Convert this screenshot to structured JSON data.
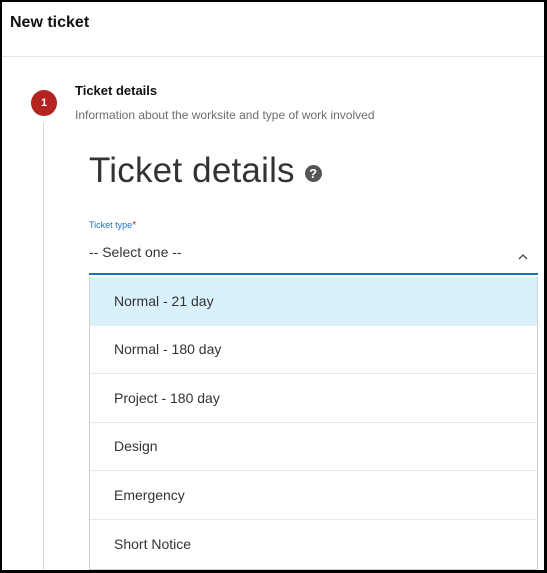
{
  "header": {
    "title": "New ticket"
  },
  "step": {
    "number": "1",
    "title": "Ticket details",
    "subtitle": "Information about the worksite and type of work involved"
  },
  "section": {
    "heading": "Ticket details",
    "help_icon": "question-circle-icon"
  },
  "ticket_type": {
    "label": "Ticket type",
    "required_marker": "*",
    "value": "-- Select one --",
    "expanded": true,
    "options": [
      {
        "label": "Normal - 21 day",
        "highlighted": true
      },
      {
        "label": "Normal - 180 day",
        "highlighted": false
      },
      {
        "label": "Project - 180 day",
        "highlighted": false
      },
      {
        "label": "Design",
        "highlighted": false
      },
      {
        "label": "Emergency",
        "highlighted": false
      },
      {
        "label": "Short Notice",
        "highlighted": false
      }
    ]
  },
  "colors": {
    "step_badge": "#b3231f",
    "accent": "#1a73c8",
    "highlight": "#d9f1fb",
    "required": "#d0232b"
  }
}
